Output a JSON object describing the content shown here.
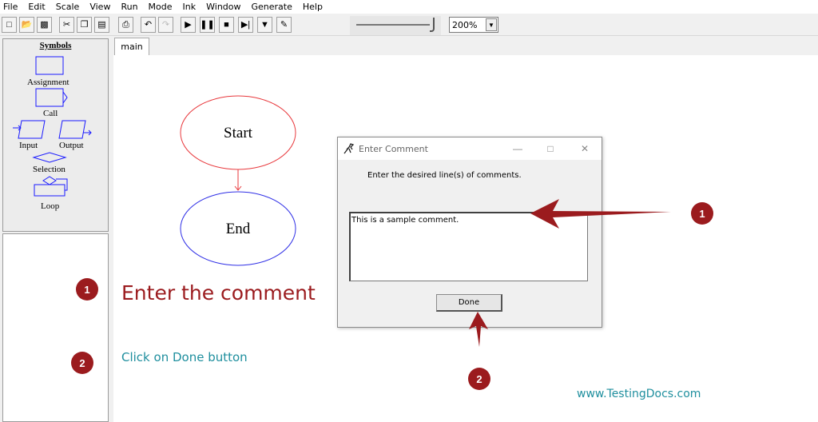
{
  "menu": [
    "File",
    "Edit",
    "Scale",
    "View",
    "Run",
    "Mode",
    "Ink",
    "Window",
    "Generate",
    "Help"
  ],
  "toolbar": {
    "zoom_value": "200%"
  },
  "tabs": [
    {
      "label": "main"
    }
  ],
  "symbols_panel": {
    "title": "Symbols",
    "items": [
      "Assignment",
      "Call",
      "Input",
      "Output",
      "Selection",
      "Loop"
    ]
  },
  "flowchart": {
    "start_label": "Start",
    "end_label": "End",
    "start_color": "#e8393d",
    "end_color": "#2f2fe6"
  },
  "dialog": {
    "title": "Enter Comment",
    "prompt": "Enter the desired line(s) of comments.",
    "comment_text": "This is a sample comment.",
    "done_label": "Done"
  },
  "annotations": {
    "badge_1": "1",
    "badge_2": "2",
    "step_1": "Enter the comment",
    "step_2": "Click on Done button",
    "watermark": "www.TestingDocs.com",
    "accent_color": "#9b1b1e",
    "teal_color": "#1f8f9e"
  }
}
